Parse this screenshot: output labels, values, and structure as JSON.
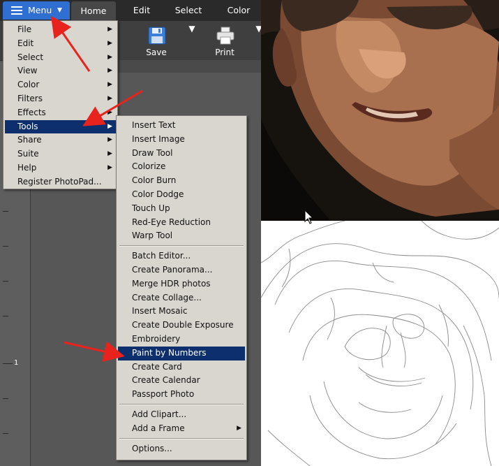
{
  "tabs": {
    "menu": "Menu",
    "home": "Home",
    "edit": "Edit",
    "select": "Select",
    "color": "Color"
  },
  "ribbon": {
    "save": "Save",
    "print": "Print"
  },
  "ruler": {
    "label": "1"
  },
  "main_menu": {
    "items": [
      {
        "label": "File",
        "submenu": true
      },
      {
        "label": "Edit",
        "submenu": true
      },
      {
        "label": "Select",
        "submenu": true
      },
      {
        "label": "View",
        "submenu": true
      },
      {
        "label": "Color",
        "submenu": true
      },
      {
        "label": "Filters",
        "submenu": true
      },
      {
        "label": "Effects",
        "submenu": true
      },
      {
        "label": "Tools",
        "submenu": true,
        "highlighted": true
      },
      {
        "label": "Share",
        "submenu": true
      },
      {
        "label": "Suite",
        "submenu": true
      },
      {
        "label": "Help",
        "submenu": true
      },
      {
        "label": "Register PhotoPad...",
        "submenu": false
      }
    ]
  },
  "tools_menu": {
    "groups": [
      [
        "Insert Text",
        "Insert Image",
        "Draw Tool",
        "Colorize",
        "Color Burn",
        "Color Dodge",
        "Touch Up",
        "Red-Eye Reduction",
        "Warp Tool"
      ],
      [
        "Batch Editor...",
        "Create Panorama...",
        "Merge HDR photos",
        "Create Collage...",
        "Insert Mosaic",
        "Create Double Exposure",
        "Embroidery",
        "Paint by Numbers",
        "Create Card",
        "Create Calendar",
        "Passport Photo"
      ],
      [
        "Add Clipart...",
        "Add a Frame"
      ],
      [
        "Options..."
      ]
    ],
    "highlighted": "Paint by Numbers",
    "submenu_items": [
      "Add a Frame"
    ]
  },
  "colors": {
    "menu_button": "#2f6fd1",
    "highlight": "#0d2f6e",
    "menu_bg": "#d9d5cf",
    "annotation_arrow": "#e8231d"
  },
  "icons": {
    "save": "floppy-disk-icon",
    "print": "printer-icon",
    "menu": "hamburger-icon",
    "submenu": "triangle-right-icon"
  }
}
